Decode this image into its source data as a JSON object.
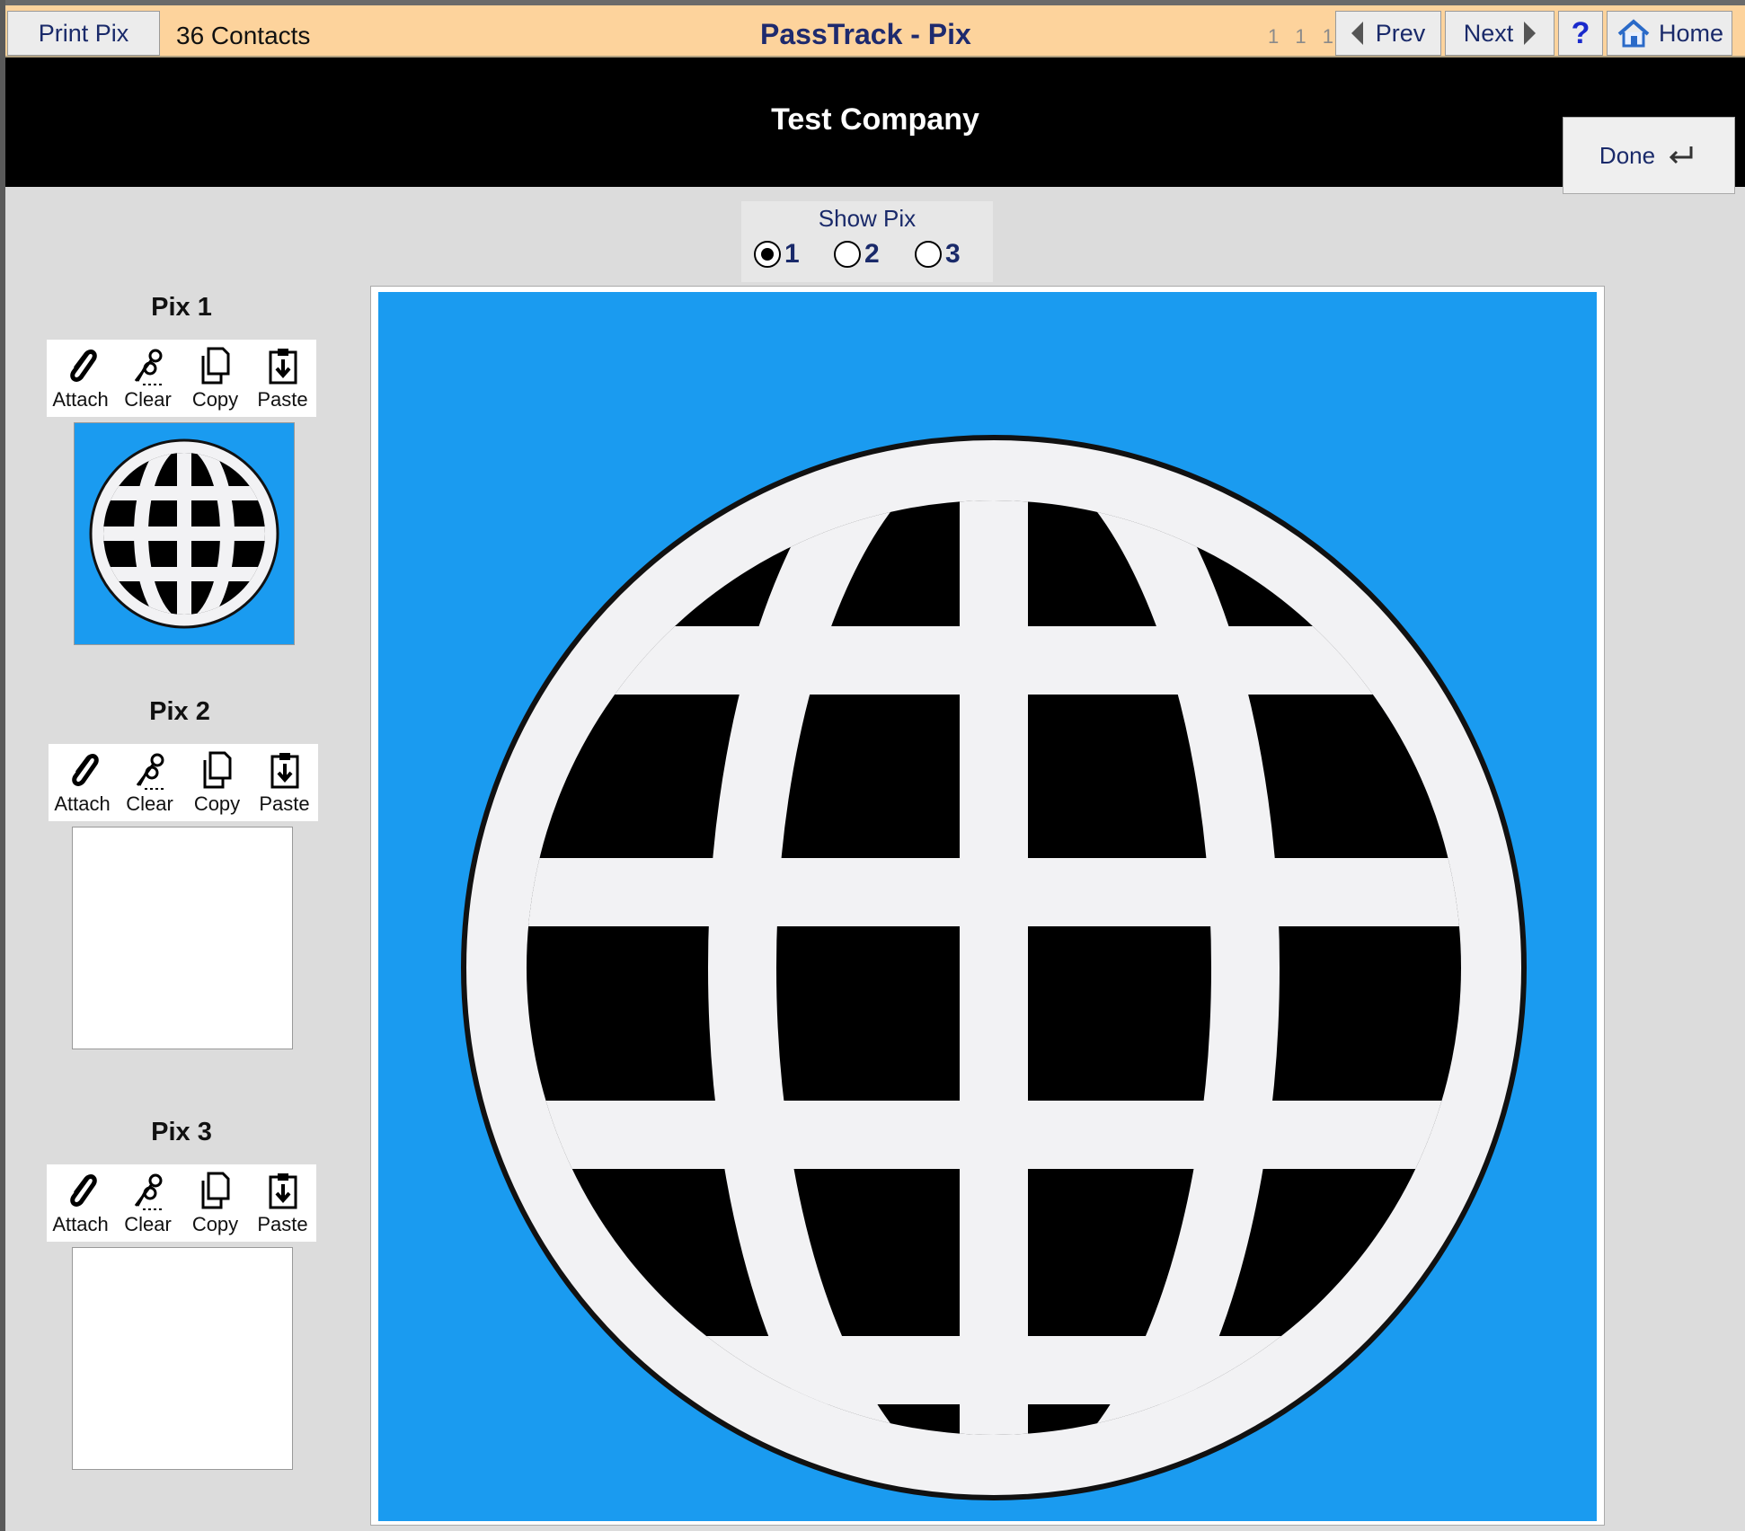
{
  "toolbar": {
    "print_label": "Print Pix",
    "contacts_label": "36 Contacts",
    "app_title": "PassTrack - Pix",
    "record_position": "1 1 1",
    "prev_label": "Prev",
    "next_label": "Next",
    "help_label": "?",
    "home_label": "Home"
  },
  "header": {
    "company": "Test Company",
    "done_label": "Done"
  },
  "show_pix": {
    "label": "Show Pix",
    "options": [
      "1",
      "2",
      "3"
    ],
    "selected": "1"
  },
  "pix_sections": [
    {
      "title": "Pix 1",
      "has_image": true,
      "image_icon": "globe-icon"
    },
    {
      "title": "Pix 2",
      "has_image": false
    },
    {
      "title": "Pix 3",
      "has_image": false
    }
  ],
  "tools": {
    "attach": "Attach",
    "clear": "Clear",
    "copy": "Copy",
    "paste": "Paste"
  },
  "main_image": {
    "icon": "globe-icon",
    "background": "#1a9bf0"
  },
  "colors": {
    "toolbar_bg": "#fdd39c",
    "header_bg": "#000000",
    "image_blue": "#1a9bf0",
    "title_blue": "#1e2a6e"
  }
}
